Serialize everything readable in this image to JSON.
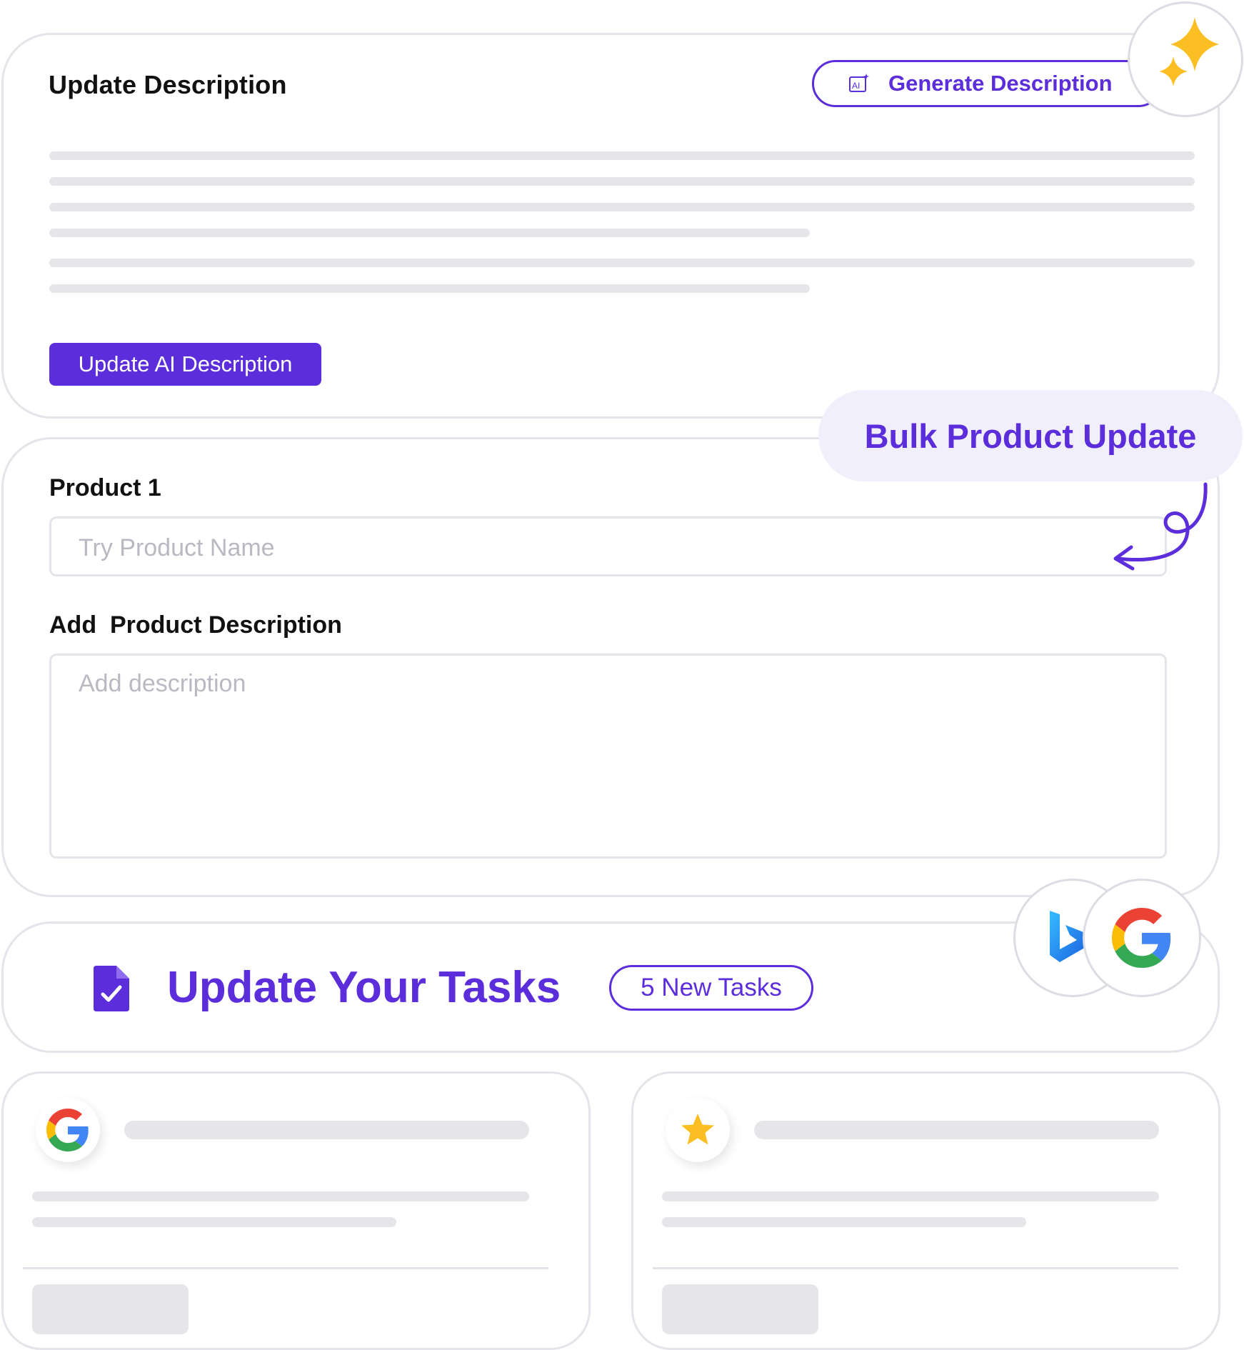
{
  "description_card": {
    "title": "Update Description",
    "generate_button_label": "Generate Description",
    "update_button_label": "Update AI Description"
  },
  "bulk_card": {
    "badge": "Bulk Product Update",
    "product_label": "Product 1",
    "product_placeholder": "Try Product Name",
    "description_label": "Add  Product Description",
    "description_placeholder": "Add description"
  },
  "tasks_card": {
    "title": "Update Your Tasks",
    "badge": "5 New Tasks"
  },
  "icons": {
    "sparkles": "sparkles-icon",
    "ai": "ai-icon",
    "task": "task-document-icon",
    "bing": "bing-logo-icon",
    "google": "google-logo-icon",
    "star": "star-icon"
  },
  "colors": {
    "accent": "#5b2ddb",
    "accent_light": "#f1effc",
    "sparkle": "#fbbf24",
    "skeleton": "#e6e6ea",
    "border": "#e4e4ea"
  }
}
